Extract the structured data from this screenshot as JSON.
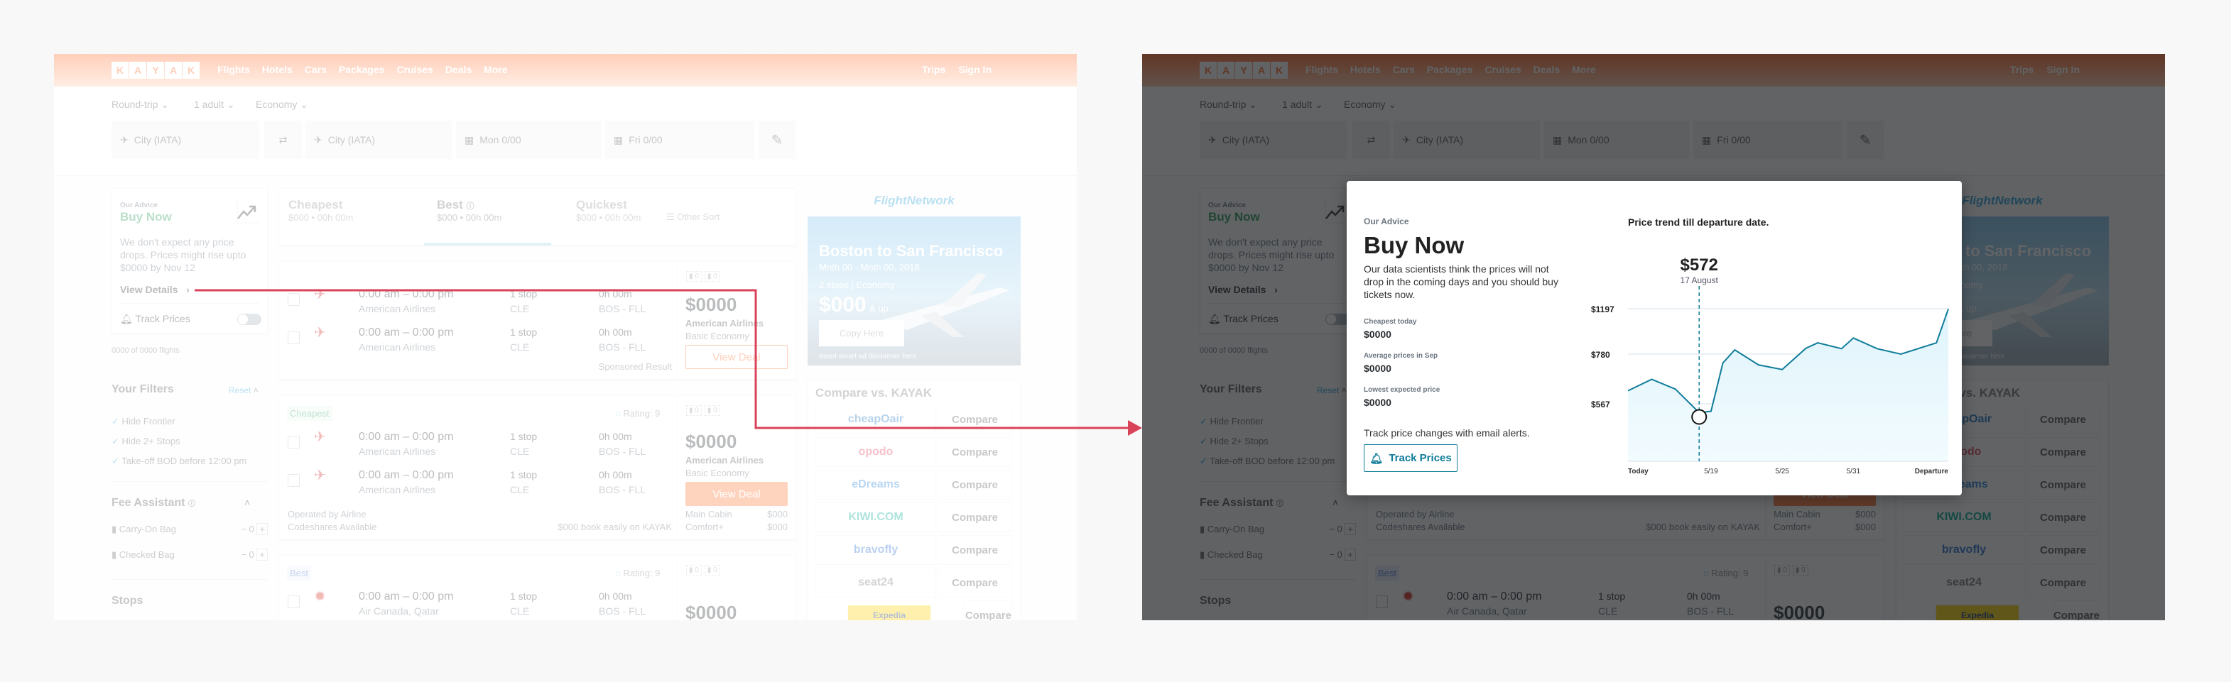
{
  "header": {
    "logo": [
      "K",
      "A",
      "Y",
      "A",
      "K"
    ],
    "nav": [
      "Flights",
      "Hotels",
      "Cars",
      "Packages",
      "Cruises",
      "Deals",
      "More"
    ],
    "right": [
      "Trips",
      "Sign In"
    ],
    "brand_color": "#ff6a2a"
  },
  "search": {
    "trip_type": "Round-trip",
    "travelers": "1 adult",
    "cabin": "Economy",
    "from": "City (IATA)",
    "to": "City (IATA)",
    "depart": "Mon 0/00",
    "return": "Fri 0/00"
  },
  "advice": {
    "label": "Our Advice",
    "verdict": "Buy Now",
    "text": "We don't expect any price drops. Prices might rise upto $0000 by Nov 12",
    "link": "View Details",
    "track": "Track Prices",
    "track_on": false
  },
  "count": "0000 of 0000 flights",
  "filters": {
    "title": "Your Filters",
    "reset": "Reset",
    "items": [
      "Hide Frontier",
      "Hide 2+ Stops",
      "Take-off BOD before 12:00 pm"
    ]
  },
  "fees": {
    "title": "Fee Assistant",
    "items": [
      {
        "label": "Carry-On Bag",
        "value": "0"
      },
      {
        "label": "Checked Bag",
        "value": "0"
      }
    ]
  },
  "stops_title": "Stops",
  "sort": {
    "tabs": [
      {
        "label": "Cheapest",
        "sub": "$000 • 00h 00m"
      },
      {
        "label": "Best",
        "sub": "$000 • 00h 00m"
      },
      {
        "label": "Quickest",
        "sub": "$000 • 00h 00m"
      }
    ],
    "other": "Other Sort",
    "active": "Best"
  },
  "flights": [
    {
      "badge": "",
      "rating": "",
      "bags": [
        "0",
        "0"
      ],
      "rows": [
        {
          "time": "0:00 am – 0:00 pm",
          "airline": "American Airlines",
          "stops": "1 stop",
          "via": "CLE",
          "duration": "0h 00m",
          "route": "BOS - FLL"
        },
        {
          "time": "0:00 am – 0:00 pm",
          "airline": "American Airlines",
          "stops": "1 stop",
          "via": "CLE",
          "duration": "0h 00m",
          "route": "BOS - FLL"
        }
      ],
      "price": "$0000",
      "price_airline": "American Airlines",
      "fare": "Basic Economy",
      "deal": "View Deal",
      "sponsored": "Sponsored Result"
    },
    {
      "badge": "Cheapest",
      "rating": "Rating: 9",
      "bags": [
        "0",
        "0"
      ],
      "rows": [
        {
          "time": "0:00 am – 0:00 pm",
          "airline": "American Airlines",
          "stops": "1 stop",
          "via": "CLE",
          "duration": "0h 00m",
          "route": "BOS - FLL"
        },
        {
          "time": "0:00 am – 0:00 pm",
          "airline": "American Airlines",
          "stops": "1 stop",
          "via": "CLE",
          "duration": "0h 00m",
          "route": "BOS - FLL"
        }
      ],
      "price": "$0000",
      "price_airline": "American Airlines",
      "fare": "Basic Economy",
      "deal": "View Deal",
      "operated": "Operated by Airline",
      "codeshares": "Codeshares Available",
      "book": "$000 book easily on KAYAK",
      "cabins": [
        {
          "name": "Main Cabin",
          "price": "$000"
        },
        {
          "name": "Comfort+",
          "price": "$000"
        }
      ]
    },
    {
      "badge": "Best",
      "rating": "Rating: 9",
      "bags": [
        "0",
        "0"
      ],
      "rows": [
        {
          "time": "0:00 am – 0:00 pm",
          "airline": "Air Canada, Qatar",
          "stops": "1 stop",
          "via": "CLE",
          "duration": "0h 00m",
          "route": "BOS - FLL"
        }
      ],
      "price": "$0000"
    }
  ],
  "ad": {
    "brand": "FlightNetwork",
    "title": "Boston to San Francisco",
    "dates": "Mnth 00 - Mnth 00, 2018",
    "details": "2 stops | Economy",
    "price": "$000",
    "price_suffix": "& up",
    "cta": "Copy Here",
    "disclaimer": "Insert smart ad disclaimer here"
  },
  "compare": {
    "title": "Compare vs. KAYAK",
    "button": "Compare",
    "providers": [
      {
        "name": "cheapOair",
        "color": "#1e73be"
      },
      {
        "name": "opodo",
        "color": "#e0405a"
      },
      {
        "name": "eDreams",
        "color": "#2a7fd4"
      },
      {
        "name": "KIWI.COM",
        "color": "#00a991"
      },
      {
        "name": "bravofly",
        "color": "#2a6fd0"
      },
      {
        "name": "seat24",
        "color": "#777777"
      },
      {
        "name": "Expedia",
        "color": "#1a3a7a"
      }
    ]
  },
  "modal": {
    "label": "Our Advice",
    "title": "Buy Now",
    "text": "Our data scientists think the prices will not drop in the coming days and you should buy tickets now.",
    "stats": [
      {
        "label": "Cheapest today",
        "value": "$0000"
      },
      {
        "label": "Average prices in Sep",
        "value": "$0000"
      },
      {
        "label": "Lowest expected price",
        "value": "$0000"
      }
    ],
    "track_text": "Track price changes with email alerts.",
    "track_button": "Track Prices",
    "accent": "#0f7c99"
  },
  "chart_data": {
    "type": "area",
    "title": "Price trend till departure date.",
    "highlight": {
      "x": "5/18",
      "price": "$572",
      "date": "17 August"
    },
    "y_ticks": [
      567,
      780,
      1197
    ],
    "y_tick_labels": [
      "$567",
      "$780",
      "$1197"
    ],
    "x_ticks": [
      {
        "x": "5/12",
        "label": "Today"
      },
      {
        "x": "5/19",
        "label": "5/19"
      },
      {
        "x": "5/25",
        "label": "5/25"
      },
      {
        "x": "5/31",
        "label": "5/31"
      },
      {
        "x": "6/8",
        "label": "Departure"
      }
    ],
    "x_range": [
      "5/12",
      "6/8"
    ],
    "grid": true,
    "x": [
      "5/12",
      "5/14",
      "5/16",
      "5/18",
      "5/19",
      "5/20",
      "5/21",
      "5/23",
      "5/25",
      "5/27",
      "5/28",
      "5/30",
      "5/31",
      "6/2",
      "6/4",
      "6/7",
      "6/8"
    ],
    "values": [
      623,
      672,
      630,
      529,
      535,
      742,
      819,
      734,
      714,
      834,
      884,
      830,
      928,
      830,
      780,
      884,
      1195
    ],
    "line_color": "#0f7c99",
    "fill_color": "#dff4fb"
  },
  "annotation_color": "#d9435a"
}
